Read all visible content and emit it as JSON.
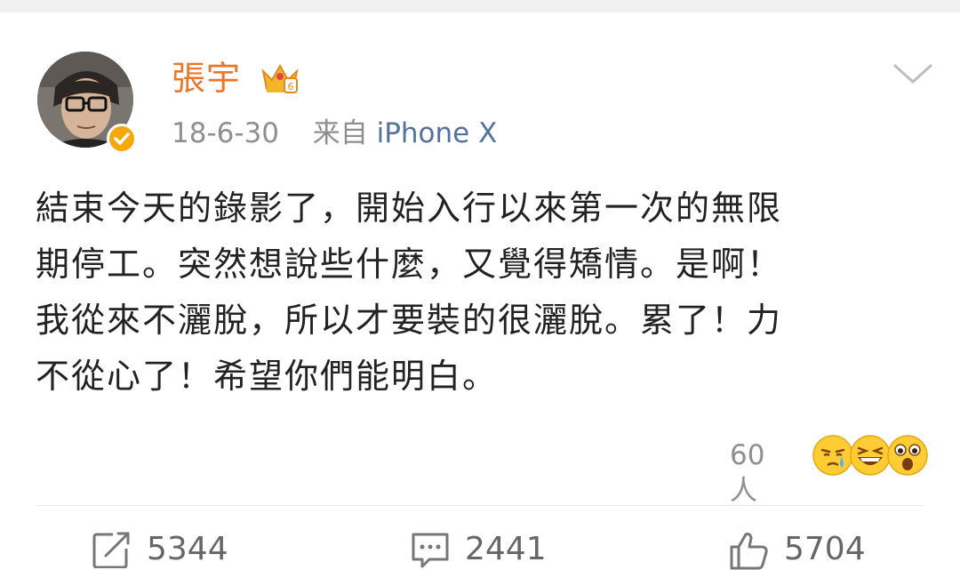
{
  "post": {
    "author": "張宇",
    "date": "18-6-30",
    "source_prefix": "来自",
    "source": "iPhone X",
    "lines": [
      "結束今天的錄影了，開始入行以來第一次的無限",
      "期停工。突然想說些什麼，又覺得矯情。是啊！",
      "我從來不灑脫，所以才要裝的很灑脫。累了！力",
      "不從心了！希望你們能明白。"
    ],
    "reaction_count": "60人",
    "reaction_emojis": [
      "crying-emoji",
      "laughing-emoji",
      "surprised-emoji"
    ]
  },
  "actions": {
    "repost_count": "5344",
    "comment_count": "2441",
    "like_count": "5704"
  },
  "colors": {
    "username": "#e8762b",
    "source_link": "#53739e",
    "verified_badge": "#f6a70a"
  }
}
